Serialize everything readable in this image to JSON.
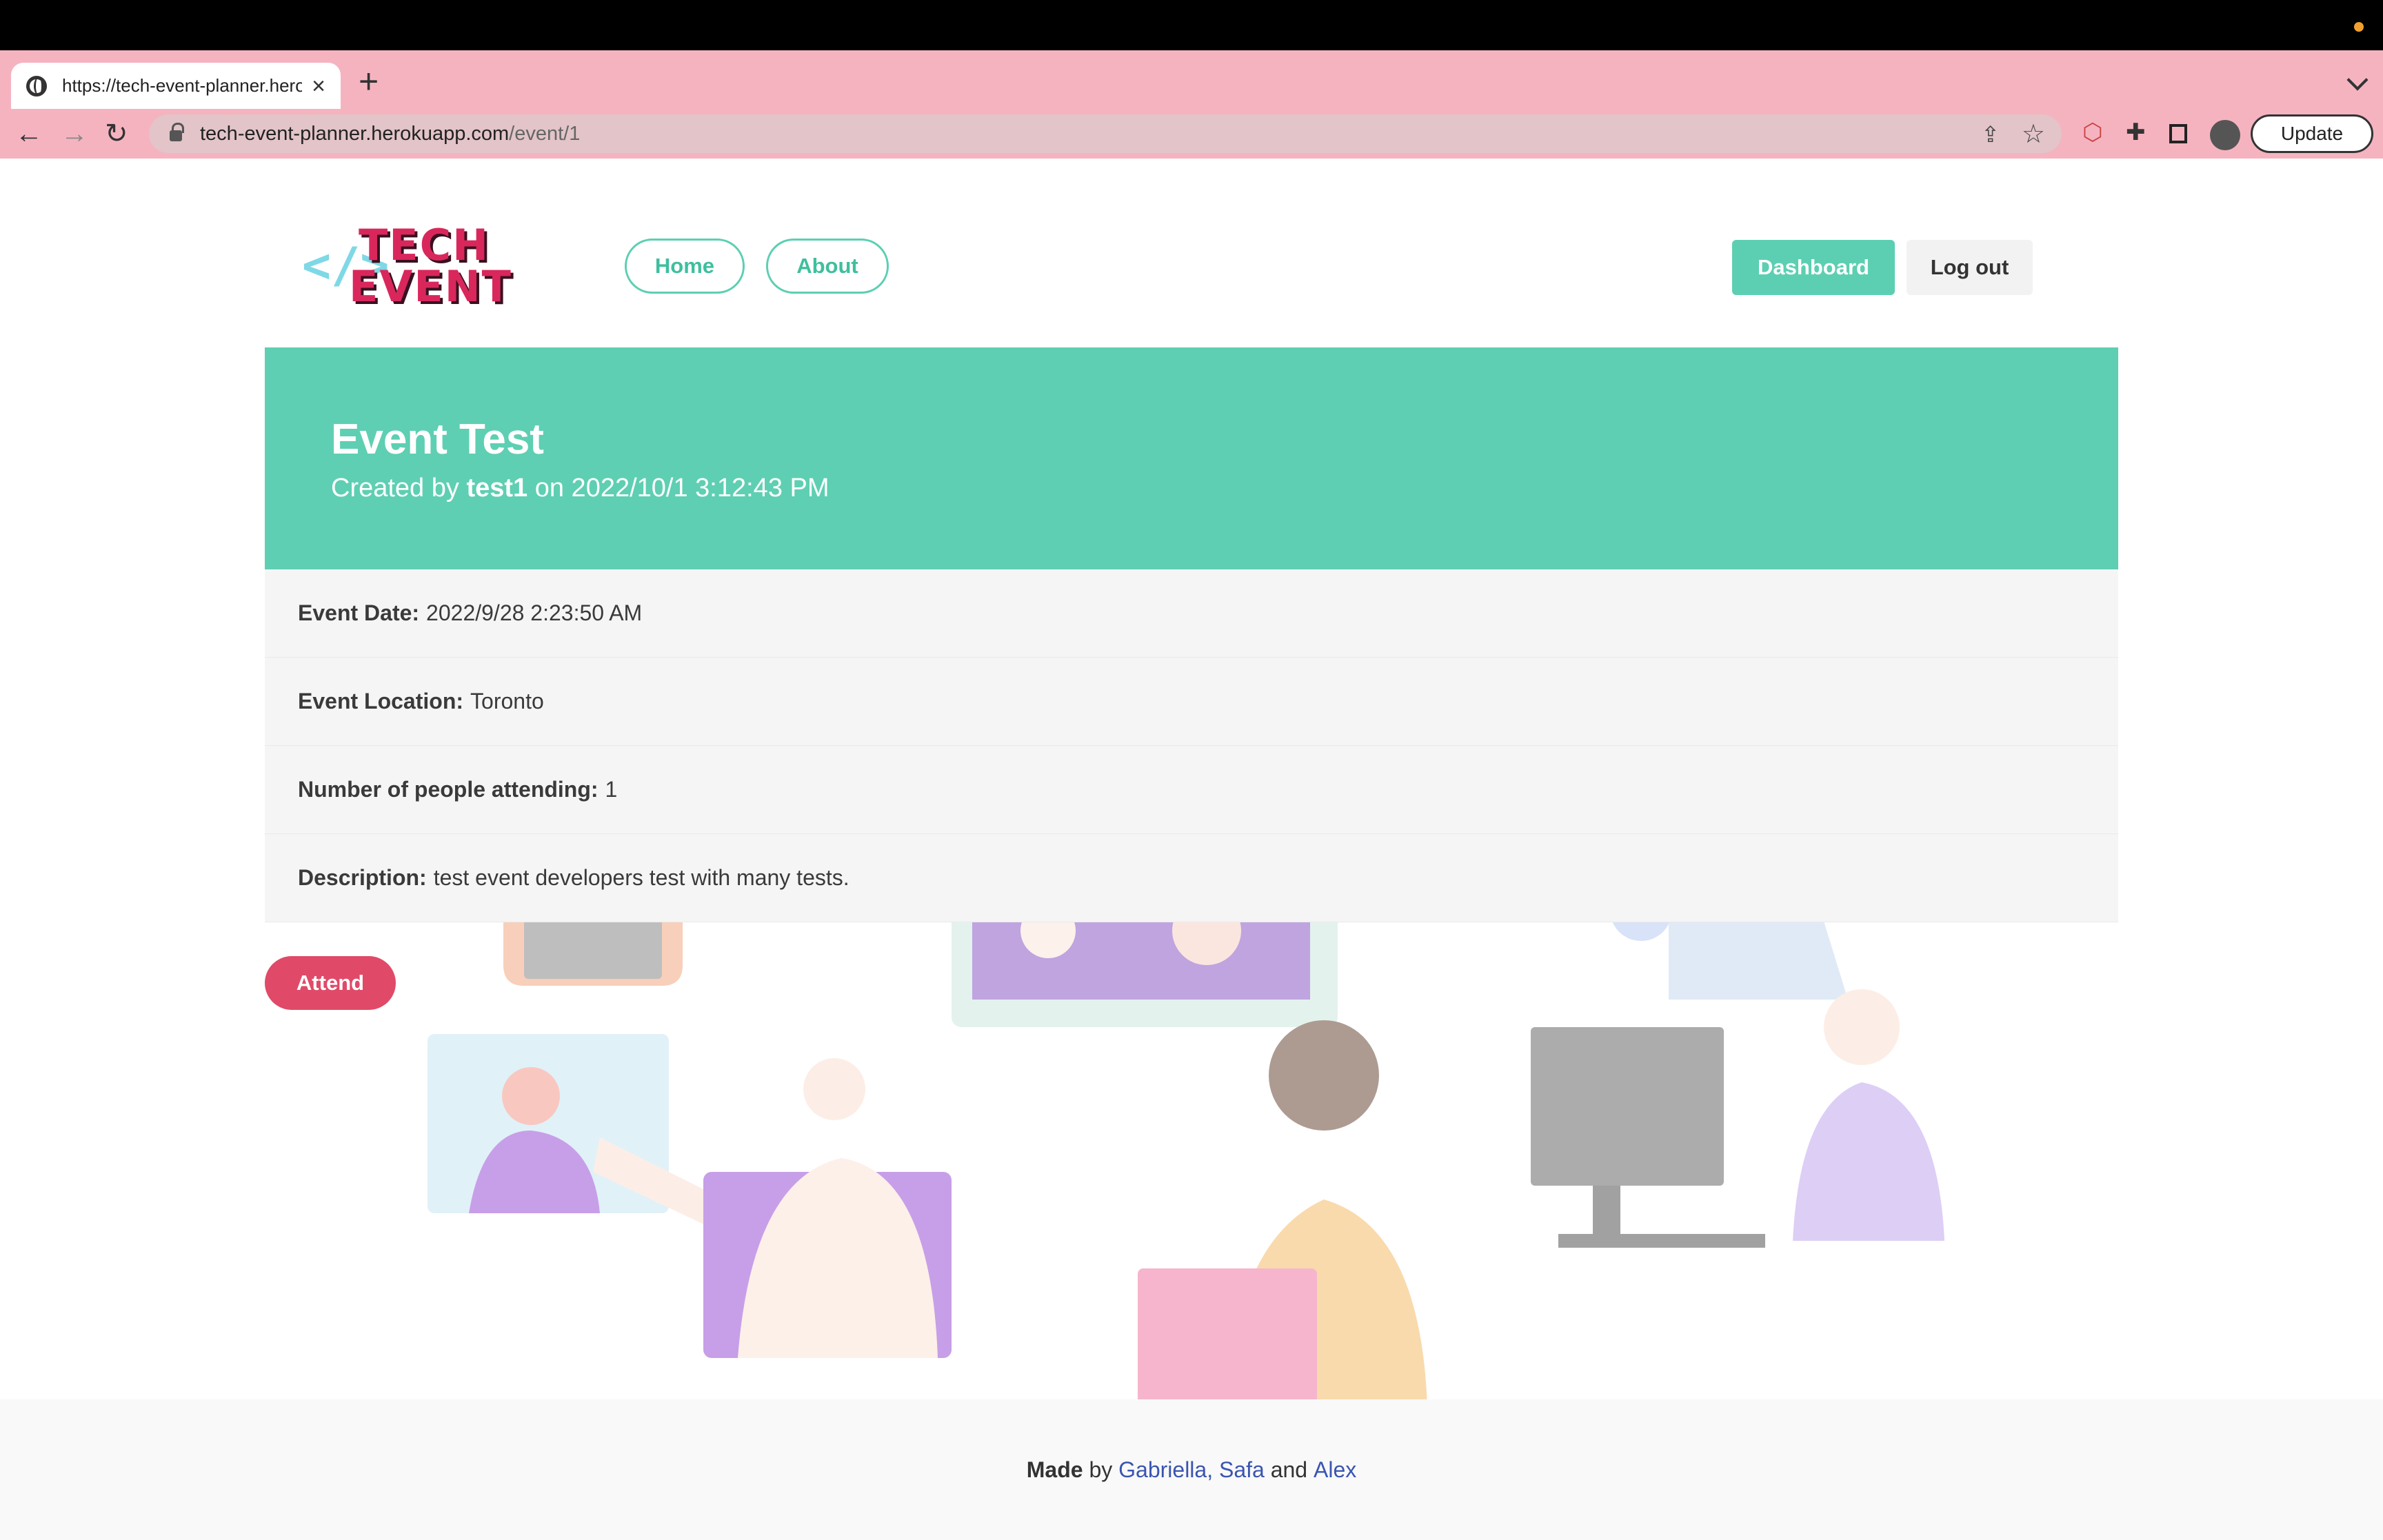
{
  "browser": {
    "tab_title": "https://tech-event-planner.herokuapp.com/event/1",
    "new_tab_symbol": "+",
    "url_host": "tech-event-planner.herokuapp.com",
    "url_path": "/event/1",
    "update_label": "Update",
    "icons": [
      "globe-icon",
      "close-icon",
      "back-arrow-icon",
      "forward-arrow-icon",
      "reload-icon",
      "lock-icon",
      "share-icon",
      "star-icon",
      "extension-icon",
      "puzzle-icon",
      "sidebar-icon"
    ]
  },
  "site": {
    "logo_code": "</>",
    "logo_line1": "TECH",
    "logo_line2": "EVENT",
    "nav": {
      "home": "Home",
      "about": "About"
    },
    "dashboard": "Dashboard",
    "logout": "Log out"
  },
  "event": {
    "title": "Event Test",
    "created_prefix": "Created by",
    "creator": "test1",
    "created_on": "on 2022/10/1 3:12:43 PM",
    "date_label": "Event Date:",
    "date_value": "2022/9/28 2:23:50 AM",
    "location_label": "Event Location:",
    "location_value": "Toronto",
    "attending_label": "Number of people attending:",
    "attending_value": "1",
    "description_label": "Description:",
    "description_value": "test event developers test with many tests.",
    "attend_button": "Attend"
  },
  "footer": {
    "made": "Made",
    "by": "by",
    "author1": "Gabriella,",
    "author2": "Safa",
    "and": "and",
    "author3": "Alex"
  },
  "colors": {
    "accent": "#5ecfb2",
    "attend": "#e04a68",
    "logo": "#d9275c",
    "tabstrip": "#f5b3c0"
  }
}
